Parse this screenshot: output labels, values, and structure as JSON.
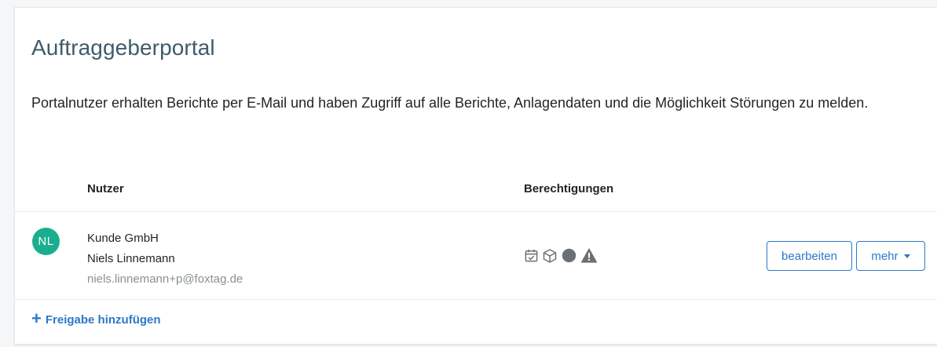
{
  "portal": {
    "title": "Auftraggeberportal",
    "description": "Portalnutzer erhalten Berichte per E-Mail und haben Zugriff auf alle Berichte, Anlagendaten und die Möglichkeit Störungen zu melden."
  },
  "table": {
    "headers": {
      "user": "Nutzer",
      "permissions": "Berechtigungen"
    },
    "rows": [
      {
        "initials": "NL",
        "avatar_color": "#1aae8f",
        "company": "Kunde GmbH",
        "name": "Niels Linnemann",
        "email": "niels.linnemann+p@foxtag.de",
        "permission_icons": [
          "calendar-check-icon",
          "cube-icon",
          "circle-icon",
          "warning-triangle-icon"
        ],
        "edit_label": "bearbeiten",
        "more_label": "mehr"
      }
    ]
  },
  "add_share": {
    "icon": "plus-icon",
    "label": "Freigabe hinzufügen"
  },
  "colors": {
    "accent": "#2d78c8",
    "title": "#3f5b6b",
    "muted": "#8a9095",
    "icon": "#6b7075"
  }
}
